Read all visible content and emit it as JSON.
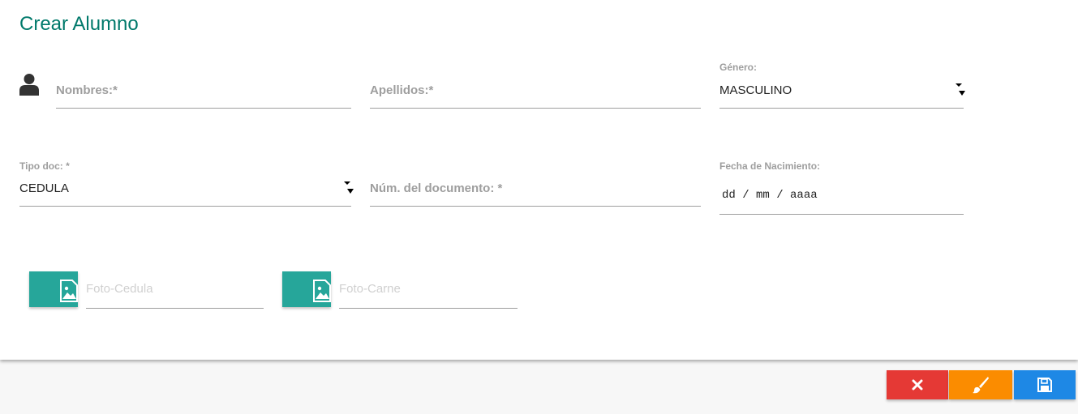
{
  "page": {
    "title": "Crear Alumno"
  },
  "form": {
    "nombres": {
      "placeholder": "Nombres:*"
    },
    "apellidos": {
      "placeholder": "Apellidos:*"
    },
    "genero": {
      "label": "Género:",
      "value": "MASCULINO"
    },
    "tipo_doc": {
      "label": "Tipo doc: *",
      "value": "CEDULA"
    },
    "num_documento": {
      "placeholder": "Núm. del documento: *"
    },
    "fecha_nacimiento": {
      "label": "Fecha de Nacimiento:",
      "placeholder": "dd / mm / aaaa"
    },
    "foto_cedula": {
      "placeholder": "Foto-Cedula",
      "icon": "image-file-icon"
    },
    "foto_carne": {
      "placeholder": "Foto-Carne",
      "icon": "image-file-icon"
    }
  },
  "actions": {
    "cancel": {
      "icon": "close-icon",
      "color": "#e53935"
    },
    "clear": {
      "icon": "brush-icon",
      "color": "#fb8c00"
    },
    "save": {
      "icon": "save-icon",
      "color": "#1e88e5"
    }
  },
  "colors": {
    "accent": "#00796b",
    "teal": "#26a69a"
  }
}
